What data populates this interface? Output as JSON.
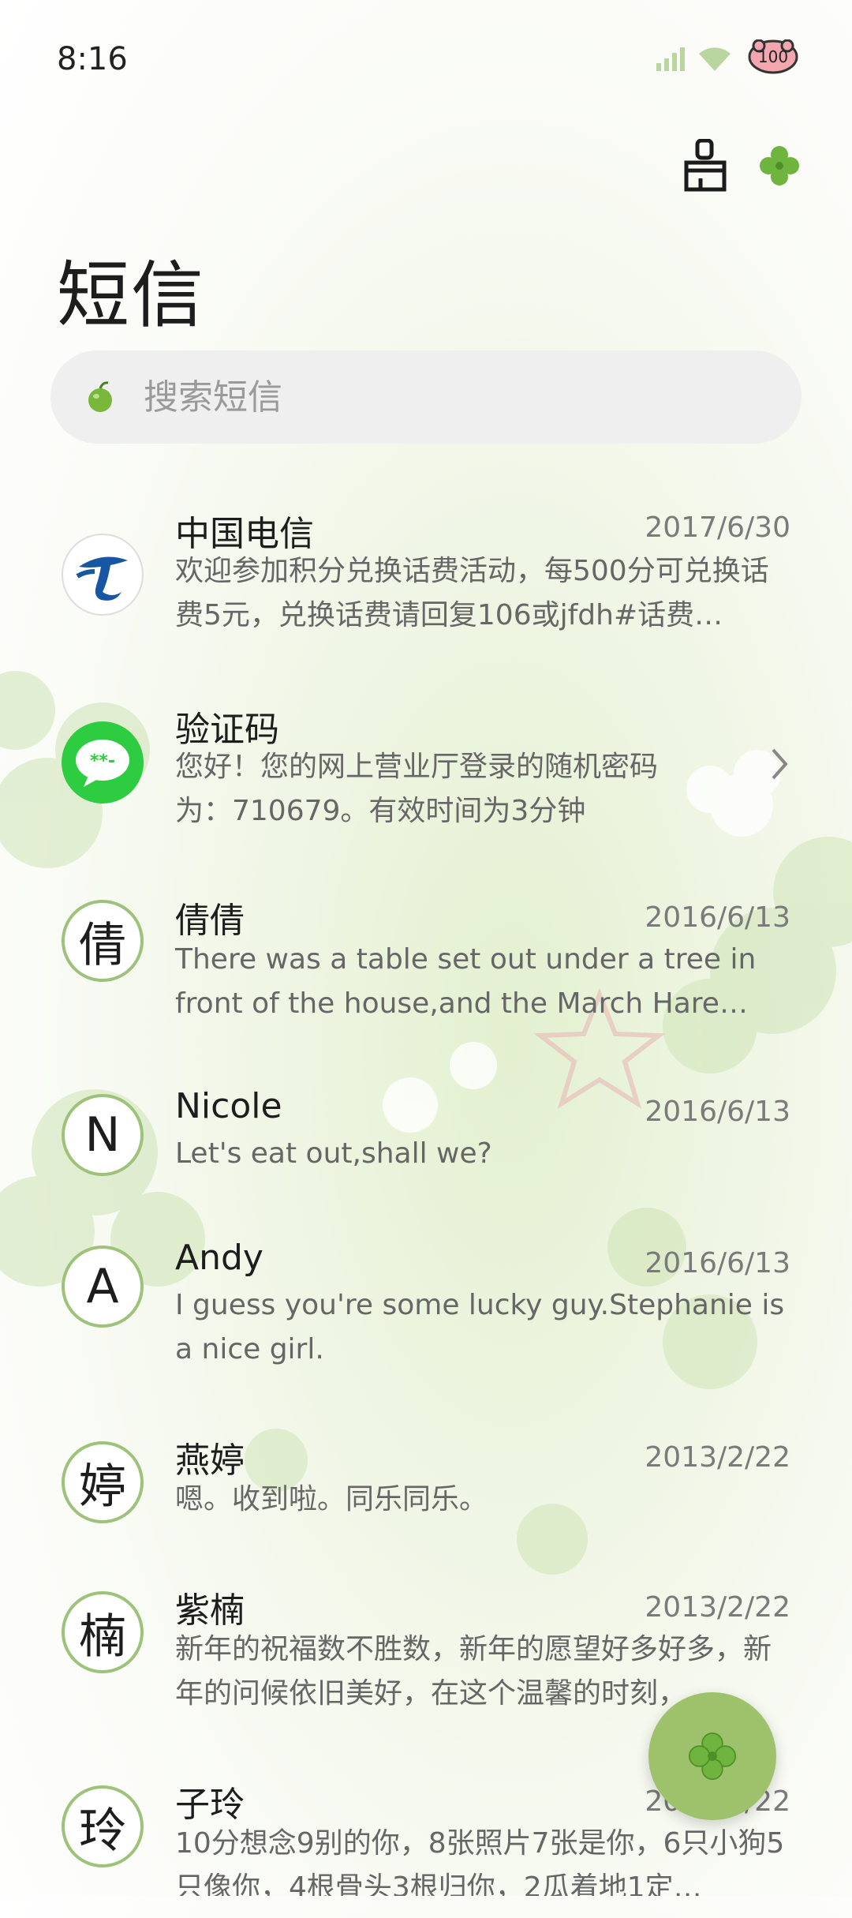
{
  "status_bar": {
    "time": "8:16",
    "battery": "100"
  },
  "header": {
    "title": "短信"
  },
  "search": {
    "placeholder": "搜索短信"
  },
  "conversations": [
    {
      "avatar": "",
      "name": "中国电信",
      "date": "2017/6/30",
      "preview": "欢迎参加积分兑换话费活动，每500分可兑换话费5元，兑换话费请回复106或jfdh#话费…"
    },
    {
      "avatar": "**-",
      "name": "验证码",
      "date": "",
      "preview": "您好！您的网上营业厅登录的随机密码为：710679。有效时间为3分钟"
    },
    {
      "avatar": "倩",
      "name": "倩倩",
      "date": "2016/6/13",
      "preview": "There was a table set out under a tree in front of the house,and the March Hare an…"
    },
    {
      "avatar": "N",
      "name": "Nicole",
      "date": "2016/6/13",
      "preview": "Let's eat out,shall we?"
    },
    {
      "avatar": "A",
      "name": "Andy",
      "date": "2016/6/13",
      "preview": "I guess you're some lucky guy.Stephanie is a nice girl."
    },
    {
      "avatar": "婷",
      "name": "燕婷",
      "date": "2013/2/22",
      "preview": "嗯。收到啦。同乐同乐。"
    },
    {
      "avatar": "楠",
      "name": "紫楠",
      "date": "2013/2/22",
      "preview": "新年的祝福数不胜数，新年的愿望好多好多，新年的问候依旧美好，在这个温馨的时刻，…"
    },
    {
      "avatar": "玲",
      "name": "子玲",
      "date": "2013/2/22",
      "preview": "10分想念9别的你，8张照片7张是你，6只小狗5只像你，4根骨头3根归你，2瓜着地1定…"
    }
  ]
}
